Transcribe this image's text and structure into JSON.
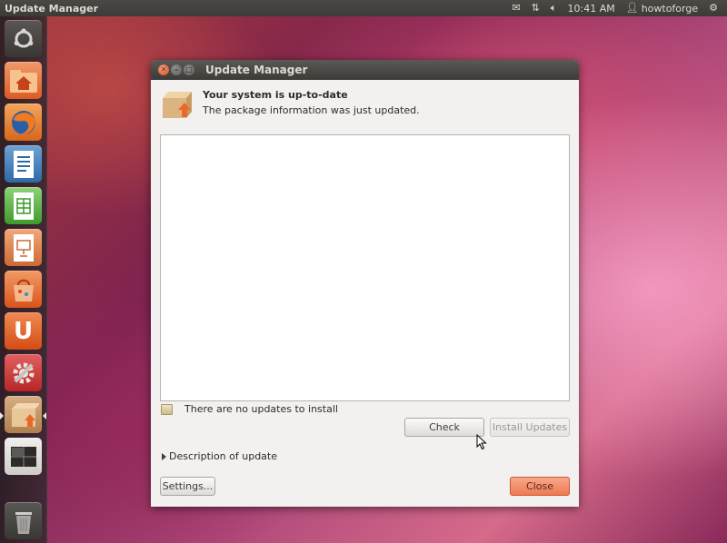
{
  "top_panel": {
    "app_title": "Update Manager",
    "mail_icon": "mail-icon",
    "network_icon": "network-icon",
    "volume_icon": "volume-icon",
    "time": "10:41 AM",
    "user": "howtoforge",
    "user_icon": "user-icon",
    "session_icon": "gear-icon"
  },
  "launcher": {
    "items": [
      {
        "name": "dash-home",
        "icon": "ubuntu-logo-icon"
      },
      {
        "name": "home-folder",
        "icon": "home-folder-icon"
      },
      {
        "name": "firefox",
        "icon": "firefox-icon"
      },
      {
        "name": "libreoffice-writer",
        "icon": "writer-icon"
      },
      {
        "name": "libreoffice-calc",
        "icon": "calc-icon"
      },
      {
        "name": "libreoffice-impress",
        "icon": "impress-icon"
      },
      {
        "name": "software-center",
        "icon": "software-center-icon"
      },
      {
        "name": "ubuntu-one",
        "icon": "ubuntu-one-icon"
      },
      {
        "name": "system-settings",
        "icon": "system-settings-icon"
      },
      {
        "name": "update-manager",
        "icon": "update-manager-icon",
        "active": true
      },
      {
        "name": "workspace-switcher",
        "icon": "workspace-switcher-icon"
      },
      {
        "name": "trash",
        "icon": "trash-icon"
      }
    ]
  },
  "dialog": {
    "title": "Update Manager",
    "heading": "Your system is up-to-date",
    "subheading": "The package information was just updated.",
    "status": "There are no updates to install",
    "check_button": "Check",
    "install_button": "Install Updates",
    "expander_label": "Description of update",
    "settings_button": "Settings...",
    "close_button": "Close"
  }
}
